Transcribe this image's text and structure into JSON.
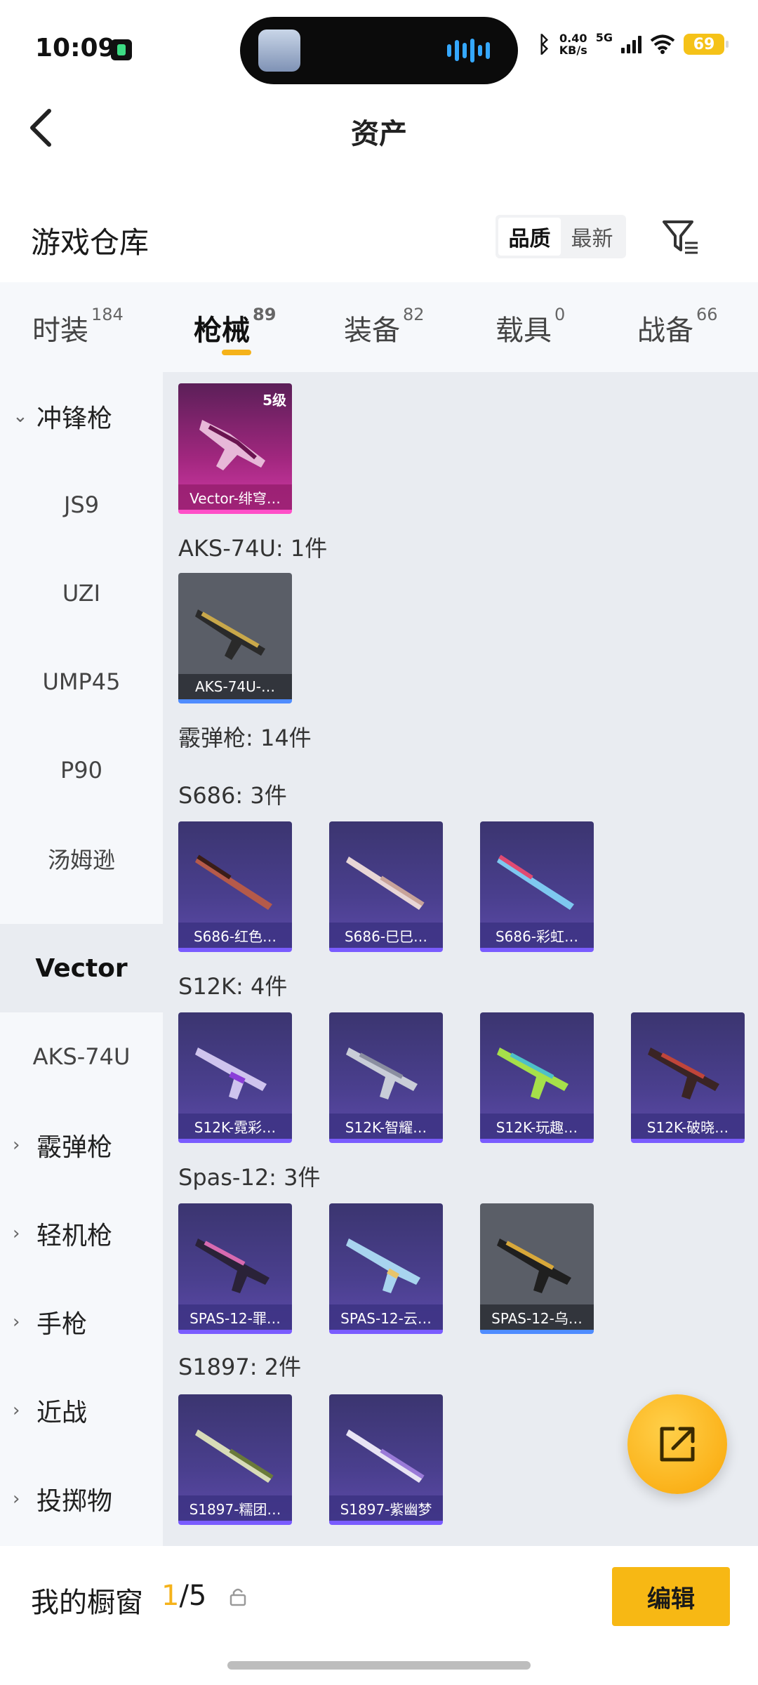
{
  "status_bar": {
    "time": "10:09",
    "speed_value": "0.40",
    "speed_unit": "KB/s",
    "network": "5G",
    "battery": "69"
  },
  "header": {
    "title": "资产"
  },
  "warehouse": {
    "title": "游戏仓库",
    "sort_options": [
      "品质",
      "最新"
    ],
    "sort_selected": "品质"
  },
  "tabs": [
    {
      "label": "时装",
      "count": "184"
    },
    {
      "label": "枪械",
      "count": "89",
      "active": true
    },
    {
      "label": "装备",
      "count": "82"
    },
    {
      "label": "载具",
      "count": "0"
    },
    {
      "label": "战备",
      "count": "66"
    }
  ],
  "sidebar": {
    "items": [
      {
        "label": "冲锋枪",
        "type": "group",
        "expanded": true
      },
      {
        "label": "JS9"
      },
      {
        "label": "UZI"
      },
      {
        "label": "UMP45"
      },
      {
        "label": "P90"
      },
      {
        "label": "汤姆逊"
      },
      {
        "label": "Vector",
        "active": true
      },
      {
        "label": "AKS-74U"
      },
      {
        "label": "霰弹枪",
        "type": "group"
      },
      {
        "label": "轻机枪",
        "type": "group"
      },
      {
        "label": "手枪",
        "type": "group"
      },
      {
        "label": "近战",
        "type": "group"
      },
      {
        "label": "投掷物",
        "type": "group"
      }
    ]
  },
  "content": {
    "vector_card": {
      "name": "Vector-绯穹…",
      "level": "5级",
      "rarity": "pink"
    },
    "aks_label": "AKS-74U: 1件",
    "aks_cards": [
      {
        "name": "AKS-74U-…",
        "rarity": "gray"
      }
    ],
    "shotgun_label": "霰弹枪: 14件",
    "s686_label": "S686: 3件",
    "s686_cards": [
      {
        "name": "S686-红色…",
        "rarity": "purple"
      },
      {
        "name": "S686-巳巳…",
        "rarity": "purple"
      },
      {
        "name": "S686-彩虹…",
        "rarity": "purple"
      }
    ],
    "s12k_label": "S12K: 4件",
    "s12k_cards": [
      {
        "name": "S12K-霓彩…",
        "rarity": "purple"
      },
      {
        "name": "S12K-智耀…",
        "rarity": "purple"
      },
      {
        "name": "S12K-玩趣…",
        "rarity": "purple"
      },
      {
        "name": "S12K-破晓…",
        "rarity": "purple"
      }
    ],
    "spas_label": "Spas-12: 3件",
    "spas_cards": [
      {
        "name": "SPAS-12-罪…",
        "rarity": "purple"
      },
      {
        "name": "SPAS-12-云…",
        "rarity": "purple"
      },
      {
        "name": "SPAS-12-乌…",
        "rarity": "gray"
      }
    ],
    "s1897_label": "S1897: 2件",
    "s1897_cards": [
      {
        "name": "S1897-糯团…",
        "rarity": "purple"
      },
      {
        "name": "S1897-紫幽梦",
        "rarity": "purple"
      }
    ]
  },
  "bottom_bar": {
    "label": "我的橱窗",
    "count_current": "1",
    "count_total": "/5",
    "edit_label": "编辑"
  },
  "colors": {
    "accent": "#f5b21a",
    "purple_rarity": "#7a5cff",
    "blue_rarity": "#4f8cff",
    "pink_rarity": "#ff4fc8"
  },
  "icons": [
    "back-arrow-icon",
    "filter-icon",
    "share-icon",
    "lock-icon",
    "chevron-down-icon",
    "chevron-right-icon",
    "bluetooth-icon",
    "wifi-icon"
  ]
}
